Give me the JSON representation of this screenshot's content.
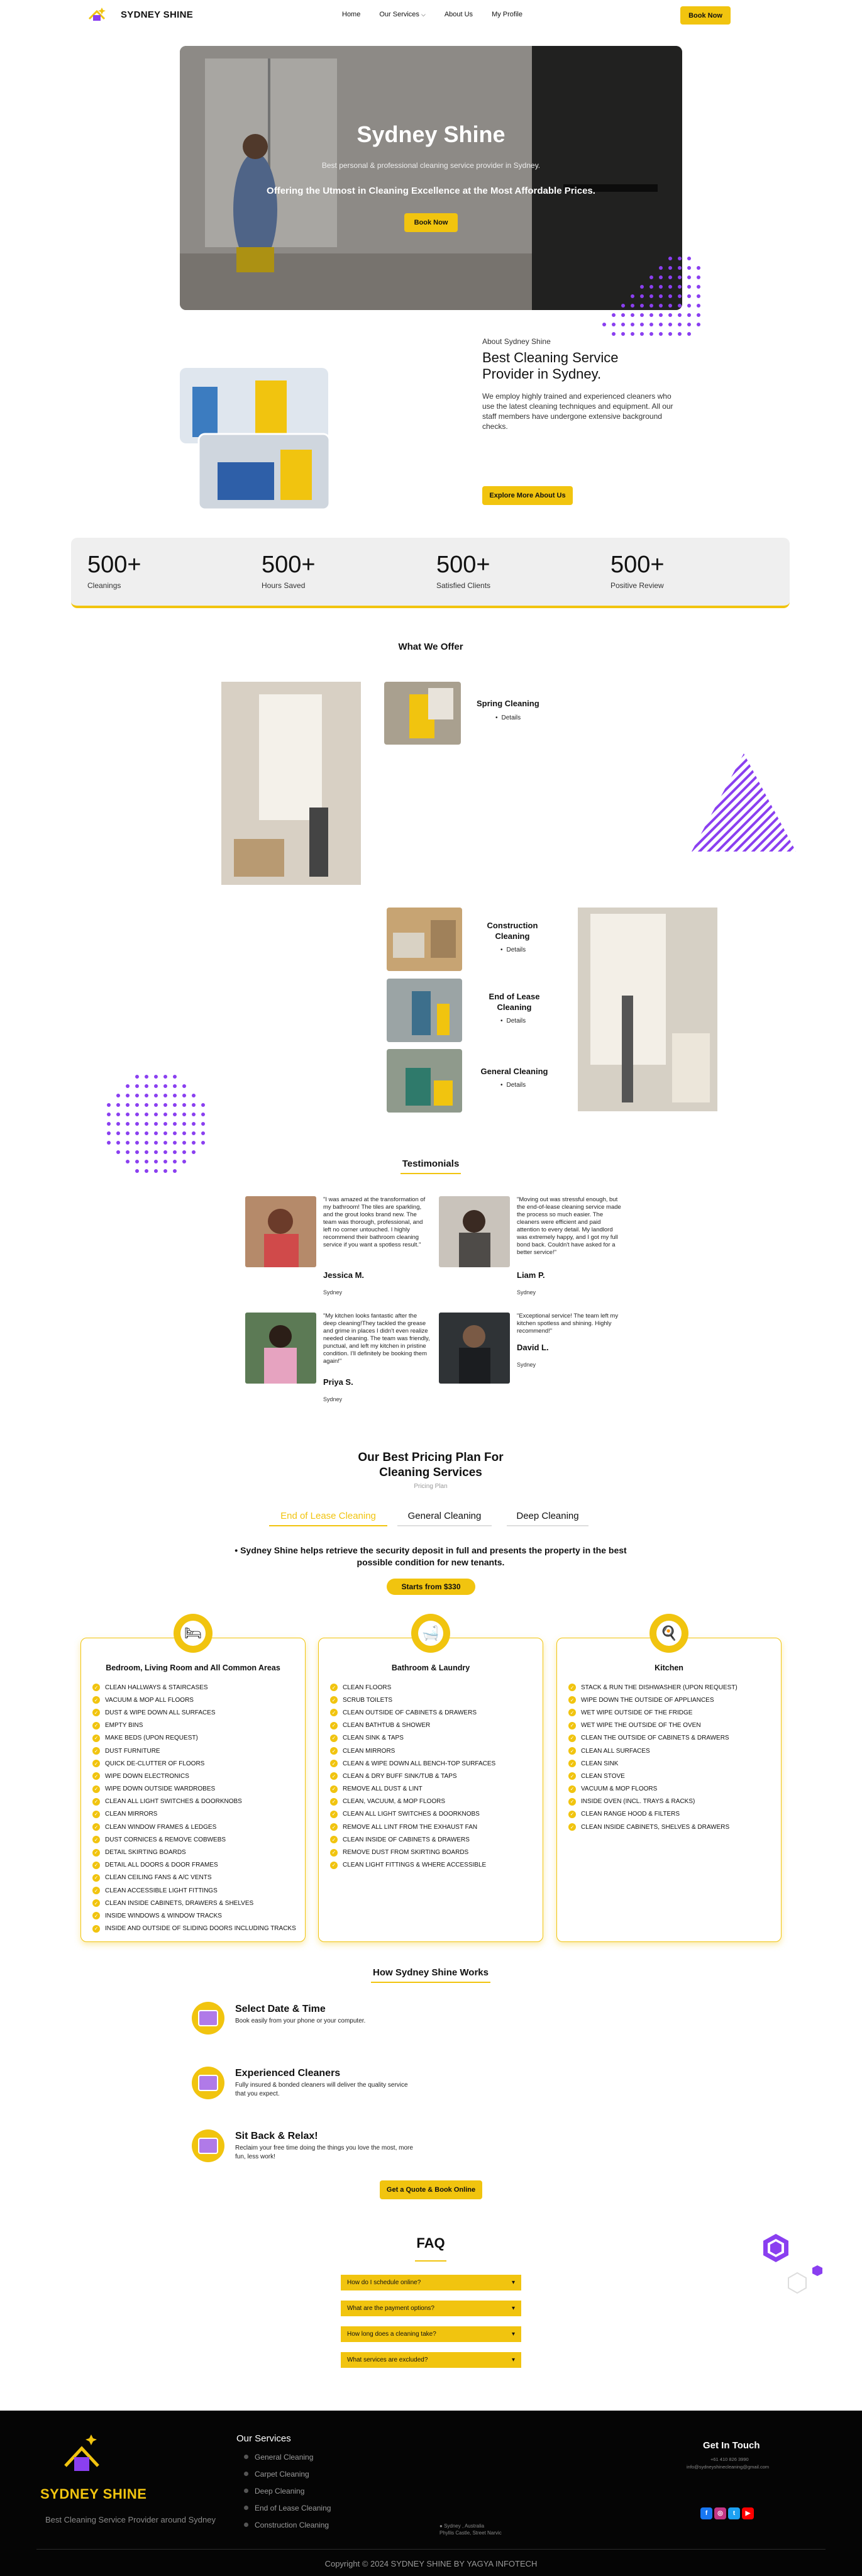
{
  "header": {
    "brand": "SYDNEY SHINE",
    "nav": [
      "Home",
      "Our Services",
      "About Us",
      "My Profile"
    ],
    "book_label": "Book Now"
  },
  "hero": {
    "title": "Sydney Shine",
    "subtitle": "Best personal & professional cleaning service provider in Sydney.",
    "tagline": "Offering the Utmost in Cleaning Excellence at the Most Affordable Prices.",
    "button": "Book Now"
  },
  "about": {
    "label": "About Sydney Shine",
    "title": "Best Cleaning Service Provider in Sydney.",
    "text": "We employ highly trained and experienced cleaners who use the latest cleaning techniques and equipment. All our staff members have undergone extensive background checks.",
    "button": "Explore More About Us"
  },
  "stats": [
    {
      "num": "500+",
      "label": "Cleanings"
    },
    {
      "num": "500+",
      "label": "Hours Saved"
    },
    {
      "num": "500+",
      "label": "Satisfied Clients"
    },
    {
      "num": "500+",
      "label": "Positive Review"
    }
  ],
  "offer": {
    "title": "What We Offer",
    "details_label": "Details",
    "services": [
      "Spring Cleaning",
      "Construction Cleaning",
      "End of Lease Cleaning",
      "General Cleaning"
    ]
  },
  "testimonials": {
    "title": "Testimonials",
    "items": [
      {
        "quote": "\"I was amazed at the transformation of my bathroom! The tiles are sparkling, and the grout looks brand new. The team was thorough, professional, and left no corner untouched. I highly recommend their bathroom cleaning service if you want a spotless result.\"",
        "name": "Jessica M.",
        "city": "Sydney"
      },
      {
        "quote": "\"Moving out was stressful enough, but the end-of-lease cleaning service made the process so much easier. The cleaners were efficient and paid attention to every detail. My landlord was extremely happy, and I got my full bond back. Couldn't have asked for a better service!\"",
        "name": "Liam P.",
        "city": "Sydney"
      },
      {
        "quote": "\"My kitchen looks fantastic after the deep cleaning!They tackled the grease and grime in places I didn't even realize needed cleaning. The team was friendly, punctual, and left my kitchen in pristine condition. I'll definitely be booking them again!\"",
        "name": "Priya S.",
        "city": "Sydney"
      },
      {
        "quote": "\"Exceptional service! The team left my kitchen spotless and shining. Highly recommend!\"",
        "name": "David L.",
        "city": "Sydney"
      }
    ]
  },
  "pricing": {
    "title": "Our Best Pricing Plan For Cleaning Services",
    "subtitle": "Pricing Plan",
    "tabs": [
      "End of Lease Cleaning",
      "General Cleaning",
      "Deep Cleaning"
    ],
    "lead": "Sydney Shine helps retrieve the security deposit in full and presents the property in the best possible condition for new tenants.",
    "price_button": "Starts from $330",
    "columns": [
      {
        "title": "Bedroom, Living Room and All Common Areas",
        "items": [
          "CLEAN HALLWAYS & STAIRCASES",
          "VACUUM & MOP ALL FLOORS",
          "DUST & WIPE DOWN ALL SURFACES",
          "EMPTY BINS",
          "MAKE BEDS (UPON REQUEST)",
          "DUST FURNITURE",
          "QUICK DE-CLUTTER OF FLOORS",
          "WIPE DOWN ELECTRONICS",
          "WIPE DOWN OUTSIDE WARDROBES",
          "CLEAN ALL LIGHT SWITCHES & DOORKNOBS",
          "CLEAN MIRRORS",
          "CLEAN WINDOW FRAMES & LEDGES",
          "DUST CORNICES & REMOVE COBWEBS",
          "DETAIL SKIRTING BOARDS",
          "DETAIL ALL DOORS & DOOR FRAMES",
          "CLEAN CEILING FANS & A/C VENTS",
          "CLEAN ACCESSIBLE LIGHT FITTINGS",
          "CLEAN INSIDE CABINETS, DRAWERS & SHELVES",
          "INSIDE WINDOWS & WINDOW TRACKS",
          "INSIDE AND OUTSIDE OF SLIDING DOORS INCLUDING TRACKS"
        ]
      },
      {
        "title": "Bathroom & Laundry",
        "items": [
          "CLEAN FLOORS",
          "SCRUB TOILETS",
          "CLEAN OUTSIDE OF CABINETS & DRAWERS",
          "CLEAN BATHTUB & SHOWER",
          "CLEAN SINK & TAPS",
          "CLEAN MIRRORS",
          "CLEAN & WIPE DOWN ALL BENCH-TOP SURFACES",
          "CLEAN & DRY BUFF SINK/TUB & TAPS",
          "REMOVE ALL DUST & LINT",
          "CLEAN, VACUUM, & MOP FLOORS",
          "CLEAN ALL LIGHT SWITCHES & DOORKNOBS",
          "REMOVE ALL LINT FROM THE EXHAUST FAN",
          "CLEAN INSIDE OF CABINETS & DRAWERS",
          "REMOVE DUST FROM SKIRTING BOARDS",
          "CLEAN LIGHT FITTINGS & WHERE ACCESSIBLE"
        ]
      },
      {
        "title": "Kitchen",
        "items": [
          "STACK & RUN THE DISHWASHER (UPON REQUEST)",
          "WIPE DOWN THE OUTSIDE OF APPLIANCES",
          "WET WIPE OUTSIDE OF THE FRIDGE",
          "WET WIPE THE OUTSIDE OF THE OVEN",
          "CLEAN THE OUTSIDE OF CABINETS & DRAWERS",
          "CLEAN ALL SURFACES",
          "CLEAN SINK",
          "CLEAN STOVE",
          "VACUUM & MOP FLOORS",
          "INSIDE OVEN (INCL. TRAYS & RACKS)",
          "CLEAN RANGE HOOD & FILTERS",
          "CLEAN INSIDE CABINETS, SHELVES & DRAWERS"
        ]
      }
    ]
  },
  "how": {
    "title": "How Sydney Shine Works",
    "steps": [
      {
        "title": "Select Date & Time",
        "text": "Book easily from your phone or your computer."
      },
      {
        "title": "Experienced Cleaners",
        "text": "Fully insured & bonded cleaners will deliver the quality service that you expect."
      },
      {
        "title": "Sit Back & Relax!",
        "text": "Reclaim your free time doing the things you love the most, more fun, less work!"
      }
    ],
    "button": "Get a Quote & Book Online"
  },
  "faq": {
    "title": "FAQ",
    "items": [
      "How do I schedule online?",
      "What are the payment options?",
      "How long does a cleaning take?",
      "What services are excluded?"
    ]
  },
  "footer": {
    "brand": "SYDNEY SHINE",
    "tagline": "Best Cleaning Service Provider around Sydney",
    "services_title": "Our Services",
    "services": [
      "General Cleaning",
      "Carpet Cleaning",
      "Deep Cleaning",
      "End of Lease Cleaning",
      "Construction Cleaning"
    ],
    "address": [
      "Sydney , Australia",
      "Phyllis Castle, Street Narvic"
    ],
    "contact_title": "Get In Touch",
    "phone": "+61 410 826 3990",
    "email": "info@sydneyshinecleaning@gmail.com",
    "copyright": "Copyright © 2024 SYDNEY SHINE  BY YAGYA INFOTECH"
  },
  "colors": {
    "accent": "#f1c40f",
    "purple": "#8a3ff0",
    "footer_bg": "#050505"
  }
}
